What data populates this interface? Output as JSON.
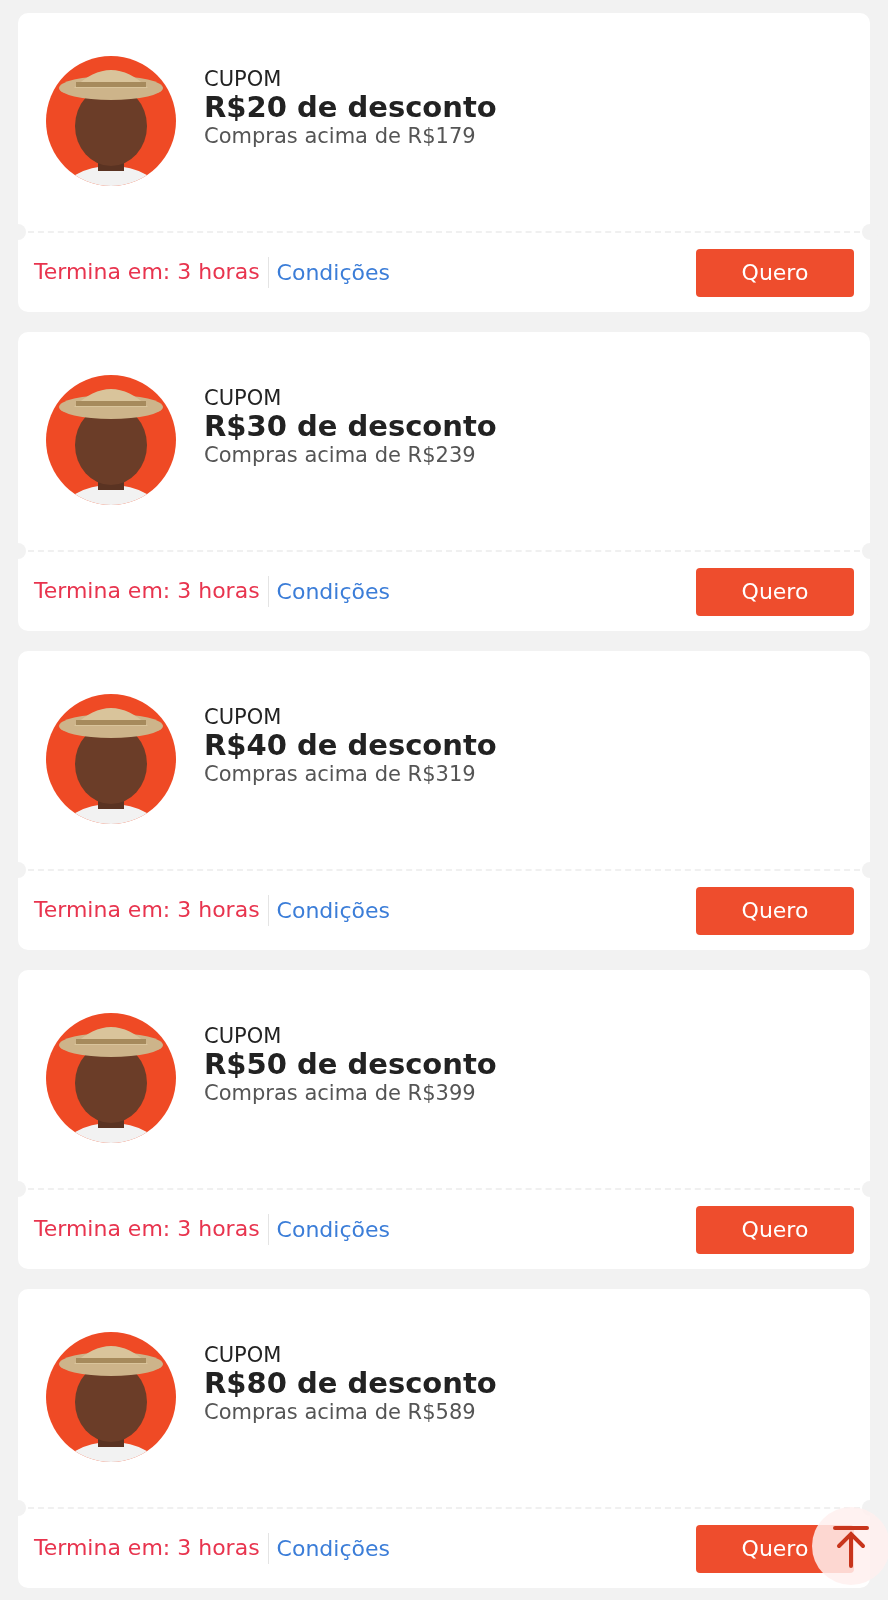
{
  "coupons": [
    {
      "label": "CUPOM",
      "title": "R$20 de desconto",
      "condition": "Compras acima de R$179",
      "expiry": "Termina em: 3 horas",
      "link": "Condições",
      "button": "Quero"
    },
    {
      "label": "CUPOM",
      "title": "R$30 de desconto",
      "condition": "Compras acima de R$239",
      "expiry": "Termina em: 3 horas",
      "link": "Condições",
      "button": "Quero"
    },
    {
      "label": "CUPOM",
      "title": "R$40 de desconto",
      "condition": "Compras acima de R$319",
      "expiry": "Termina em: 3 horas",
      "link": "Condições",
      "button": "Quero"
    },
    {
      "label": "CUPOM",
      "title": "R$50 de desconto",
      "condition": "Compras acima de R$399",
      "expiry": "Termina em: 3 horas",
      "link": "Condições",
      "button": "Quero"
    },
    {
      "label": "CUPOM",
      "title": "R$80 de desconto",
      "condition": "Compras acima de R$589",
      "expiry": "Termina em: 3 horas",
      "link": "Condições",
      "button": "Quero"
    }
  ]
}
